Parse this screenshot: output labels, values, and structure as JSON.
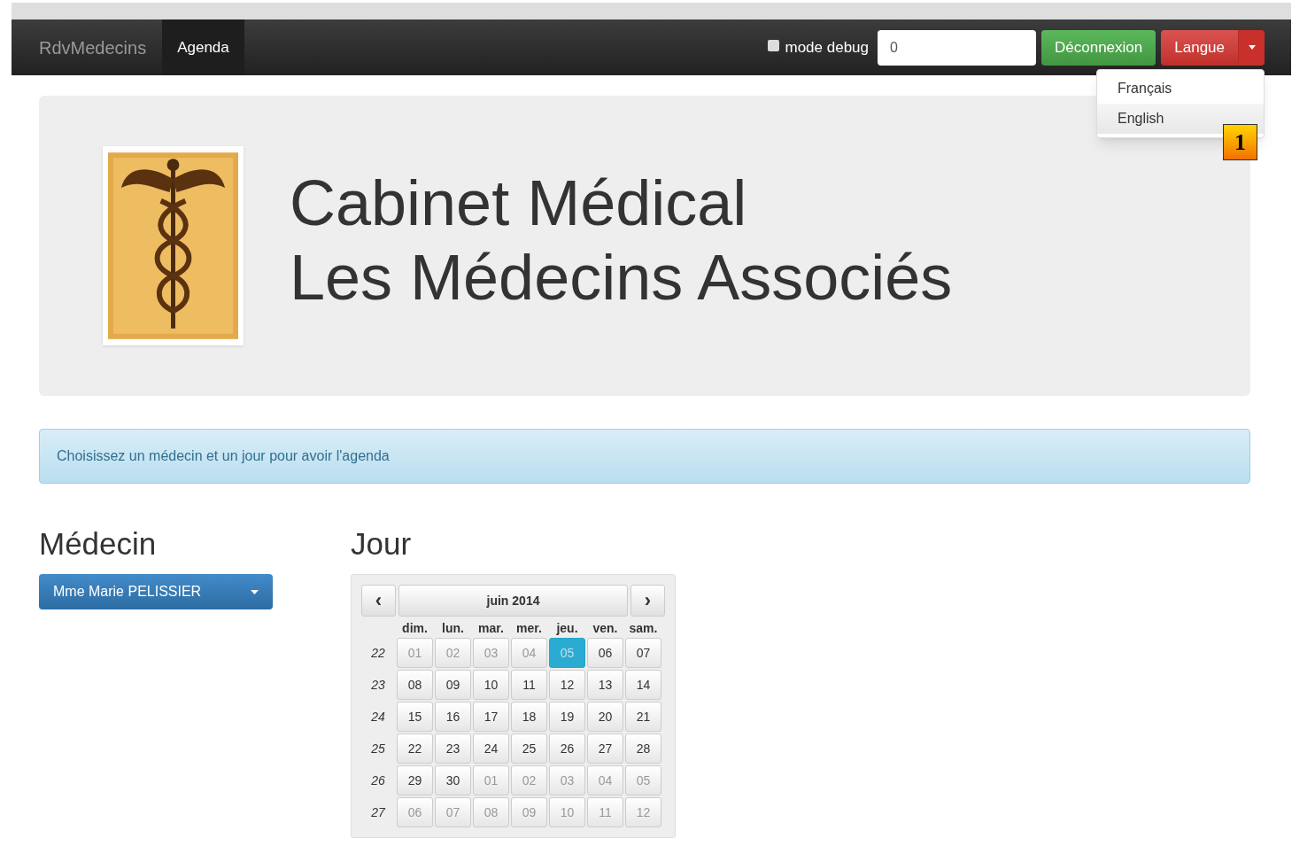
{
  "navbar": {
    "brand": "RdvMedecins",
    "links": [
      {
        "label": "Agenda",
        "selected": true
      }
    ],
    "debug": {
      "label": "mode debug",
      "checked": false
    },
    "field": {
      "value": "0"
    },
    "logout": "Déconnexion",
    "language": {
      "label": "Langue",
      "expanded": true,
      "options": [
        {
          "label": "Français",
          "selected": false
        },
        {
          "label": "English",
          "selected": true
        }
      ]
    }
  },
  "callout": "1",
  "jumbotron": {
    "title_lines": [
      "Cabinet Médical",
      "Les Médecins Associés"
    ]
  },
  "alert": "Choisissez un médecin et un jour pour avoir l'agenda",
  "doctor": {
    "heading": "Médecin",
    "value": "Mme Marie PELISSIER"
  },
  "day": {
    "heading": "Jour",
    "calendar": {
      "prev": "‹",
      "next": "›",
      "month": "juin 2014",
      "weekdays": [
        "dim.",
        "lun.",
        "mar.",
        "mer.",
        "jeu.",
        "ven.",
        "sam."
      ],
      "weeks": [
        {
          "week": "22",
          "days": [
            {
              "label": "01",
              "muted": true,
              "selected": false
            },
            {
              "label": "02",
              "muted": true,
              "selected": false
            },
            {
              "label": "03",
              "muted": true,
              "selected": false
            },
            {
              "label": "04",
              "muted": true,
              "selected": false
            },
            {
              "label": "05",
              "muted": true,
              "selected": true
            },
            {
              "label": "06",
              "muted": false,
              "selected": false
            },
            {
              "label": "07",
              "muted": false,
              "selected": false
            }
          ]
        },
        {
          "week": "23",
          "days": [
            {
              "label": "08",
              "muted": false,
              "selected": false
            },
            {
              "label": "09",
              "muted": false,
              "selected": false
            },
            {
              "label": "10",
              "muted": false,
              "selected": false
            },
            {
              "label": "11",
              "muted": false,
              "selected": false
            },
            {
              "label": "12",
              "muted": false,
              "selected": false
            },
            {
              "label": "13",
              "muted": false,
              "selected": false
            },
            {
              "label": "14",
              "muted": false,
              "selected": false
            }
          ]
        },
        {
          "week": "24",
          "days": [
            {
              "label": "15",
              "muted": false,
              "selected": false
            },
            {
              "label": "16",
              "muted": false,
              "selected": false
            },
            {
              "label": "17",
              "muted": false,
              "selected": false
            },
            {
              "label": "18",
              "muted": false,
              "selected": false
            },
            {
              "label": "19",
              "muted": false,
              "selected": false
            },
            {
              "label": "20",
              "muted": false,
              "selected": false
            },
            {
              "label": "21",
              "muted": false,
              "selected": false
            }
          ]
        },
        {
          "week": "25",
          "days": [
            {
              "label": "22",
              "muted": false,
              "selected": false
            },
            {
              "label": "23",
              "muted": false,
              "selected": false
            },
            {
              "label": "24",
              "muted": false,
              "selected": false
            },
            {
              "label": "25",
              "muted": false,
              "selected": false
            },
            {
              "label": "26",
              "muted": false,
              "selected": false
            },
            {
              "label": "27",
              "muted": false,
              "selected": false
            },
            {
              "label": "28",
              "muted": false,
              "selected": false
            }
          ]
        },
        {
          "week": "26",
          "days": [
            {
              "label": "29",
              "muted": false,
              "selected": false
            },
            {
              "label": "30",
              "muted": false,
              "selected": false
            },
            {
              "label": "01",
              "muted": true,
              "selected": false
            },
            {
              "label": "02",
              "muted": true,
              "selected": false
            },
            {
              "label": "03",
              "muted": true,
              "selected": false
            },
            {
              "label": "04",
              "muted": true,
              "selected": false
            },
            {
              "label": "05",
              "muted": true,
              "selected": false
            }
          ]
        },
        {
          "week": "27",
          "days": [
            {
              "label": "06",
              "muted": true,
              "selected": false
            },
            {
              "label": "07",
              "muted": true,
              "selected": false
            },
            {
              "label": "08",
              "muted": true,
              "selected": false
            },
            {
              "label": "09",
              "muted": true,
              "selected": false
            },
            {
              "label": "10",
              "muted": true,
              "selected": false
            },
            {
              "label": "11",
              "muted": true,
              "selected": false
            },
            {
              "label": "12",
              "muted": true,
              "selected": false
            }
          ]
        }
      ]
    }
  }
}
